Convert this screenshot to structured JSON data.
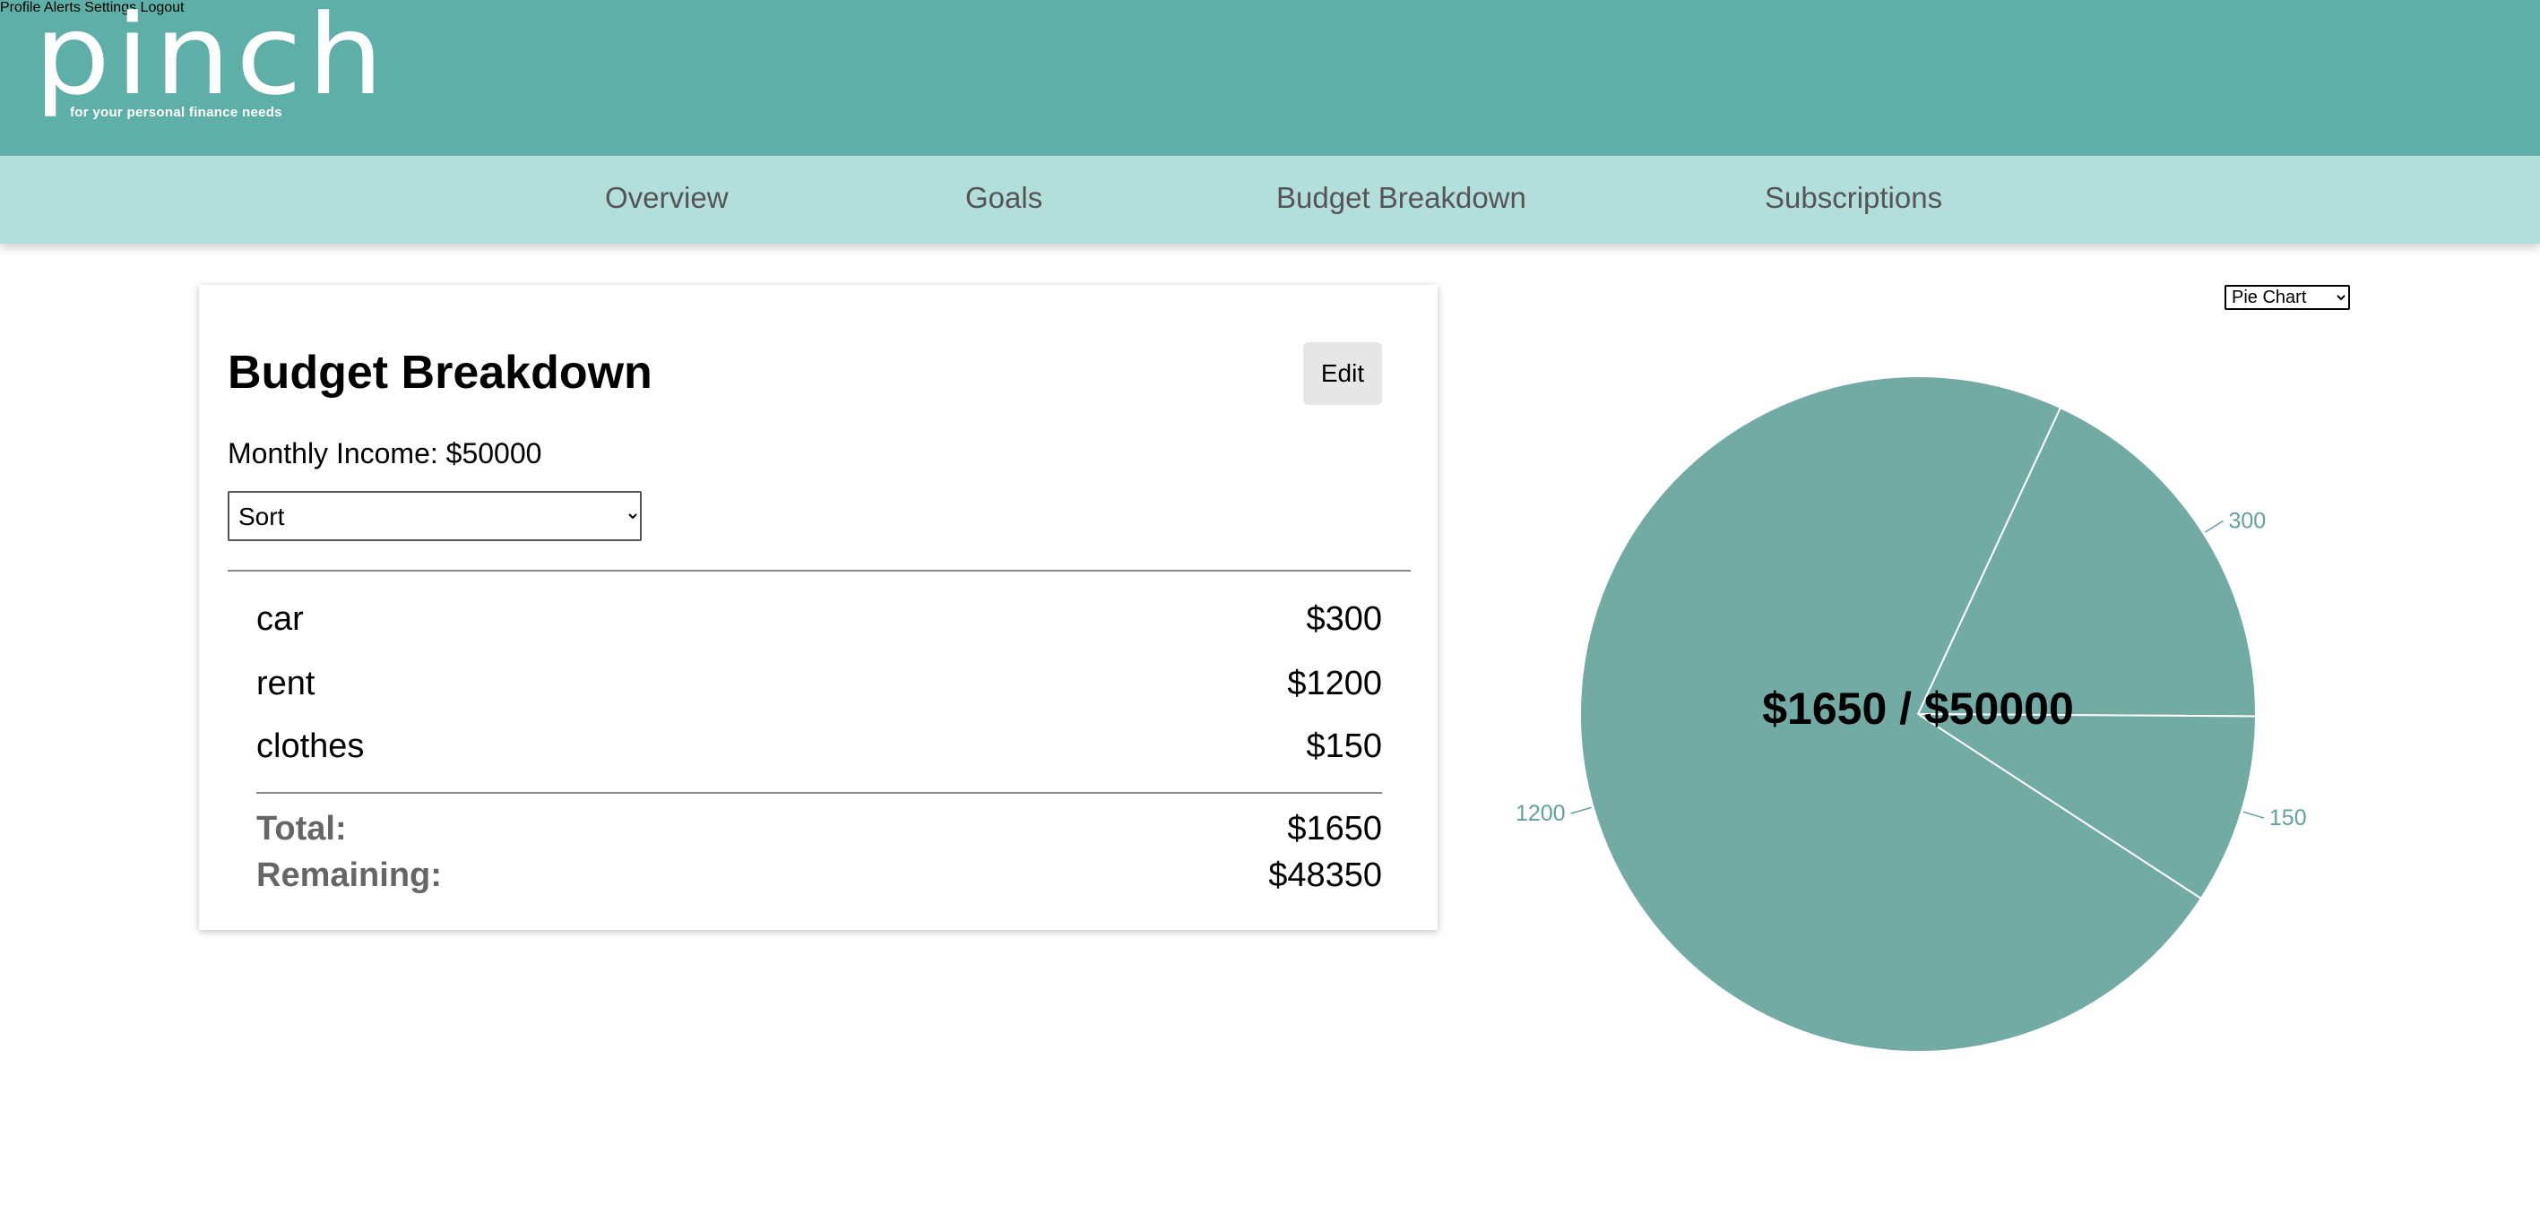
{
  "header": {
    "logo_text": "pinch",
    "logo_tagline": "for your personal finance needs",
    "nav": [
      "Profile",
      "Alerts",
      "Settings",
      "Logout"
    ]
  },
  "subnav": [
    "Overview",
    "Goals",
    "Budget Breakdown",
    "Subscriptions"
  ],
  "budget": {
    "title": "Budget Breakdown",
    "edit_label": "Edit",
    "income_text": "Monthly Income: $50000",
    "sort_value": "Sort",
    "items": [
      {
        "name": "car",
        "amount": "$300"
      },
      {
        "name": "rent",
        "amount": "$1200"
      },
      {
        "name": "clothes",
        "amount": "$150"
      }
    ],
    "total_label": "Total:",
    "total_value": "$1650",
    "remaining_label": "Remaining:",
    "remaining_value": "$48350"
  },
  "chart_selector": "Pie Chart",
  "chart_data": {
    "type": "pie",
    "center_label": "$1650 / $50000",
    "slices": [
      {
        "value": 300,
        "label": "300"
      },
      {
        "value": 150,
        "label": "150"
      },
      {
        "value": 1200,
        "label": "1200"
      }
    ],
    "color": "#72aaa4",
    "label_color": "#5fa39d"
  }
}
